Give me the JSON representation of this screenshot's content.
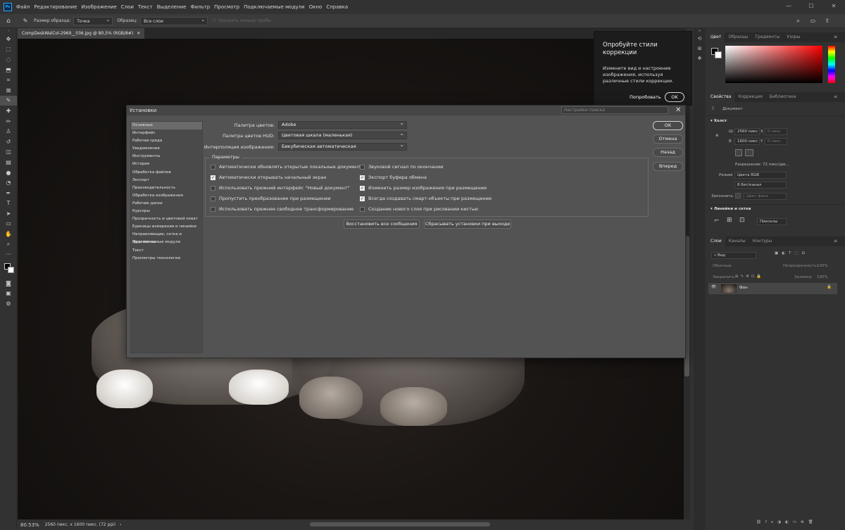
{
  "menubar": {
    "items": [
      "Файл",
      "Редактирование",
      "Изображение",
      "Слои",
      "Текст",
      "Выделение",
      "Фильтр",
      "Просмотр",
      "Подключаемые модули",
      "Окно",
      "Справка"
    ],
    "app_icon": "Ps"
  },
  "options_bar": {
    "sample_size_label": "Размер образца:",
    "sample_size_value": "Точка",
    "sample_label": "Образец:",
    "sample_value": "Все слои",
    "show_ring_label": "Показать кольцо пробы"
  },
  "document": {
    "tab_title": "CompDeskWalCol-2969__036.jpg @ 80,5% (RGB/8#)",
    "zoom": "80.53%",
    "info": "2560 пикс. x 1600 пикс. (72 ppi)"
  },
  "popup": {
    "title": "Опробуйте стили коррекции",
    "description": "Измените вид и настроение изображения, используя различные стили коррекции.",
    "try_label": "Попробовать",
    "ok_label": "OK"
  },
  "color_panel": {
    "tabs": [
      "Цвет",
      "Образцы",
      "Градиенты",
      "Узоры"
    ],
    "active": 0
  },
  "properties_panel": {
    "tabs": [
      "Свойства",
      "Коррекция",
      "Библиотеки"
    ],
    "active": 0,
    "doc_label": "Документ",
    "canvas_header": "Холст",
    "w_label": "Ш",
    "w_value": "2560 пикс",
    "h_label": "В",
    "h_value": "1600 пикс",
    "x_label": "X",
    "x_value": "0 пикс",
    "y_label": "Y",
    "y_value": "0 пикс",
    "resolution": "Разрешение: 72 пикс/дю...",
    "mode_label": "Режим",
    "mode_value": "Цвета RGB",
    "depth_value": "8 бит/канал",
    "fill_label": "Заполнить",
    "fill_value": "Цвет фона",
    "rulers_header": "Линейки и сетки",
    "units_value": "Пикселы"
  },
  "layers_panel": {
    "tabs": [
      "Слои",
      "Каналы",
      "Контуры"
    ],
    "active": 0,
    "search_placeholder": "Вид",
    "blend_mode": "Обычные",
    "opacity_label": "Непрозрачность:",
    "opacity_value": "100%",
    "lock_label": "Закрепить:",
    "fill_label": "Заливка:",
    "fill_value": "100%",
    "layer_name": "Фон"
  },
  "dialog": {
    "title": "Установки",
    "search_placeholder": "Настройки поиска",
    "categories": [
      "Основные",
      "Интерфейс",
      "Рабочая среда",
      "Уведомления",
      "Инструменты",
      "История",
      "Обработка файлов",
      "Экспорт",
      "Производительность",
      "Обработка изображения",
      "Рабочие диски",
      "Курсоры",
      "Прозрачность и цветовой охват",
      "Единицы измерения и линейки",
      "Направляющие, сетка и фрагменты",
      "Подключаемые модули",
      "Текст",
      "Просмотры технологии"
    ],
    "active_category": 0,
    "color_picker_label": "Палитра цветов:",
    "color_picker_value": "Adobe",
    "hud_label": "Палитра цветов HUD:",
    "hud_value": "Цветовая шкала (маленькая)",
    "interp_label": "Интерполяция изображения:",
    "interp_value": "Бикубическая автоматическая",
    "params_legend": "Параметры",
    "options_left": [
      {
        "label": "Автоматически обновлять открытые локальные документы",
        "checked": false
      },
      {
        "label": "Автоматически открывать начальный экран",
        "checked": true
      },
      {
        "label": "Использовать прежний интерфейс \"Новый документ\"",
        "checked": false
      },
      {
        "label": "Пропустить преобразование при размещении",
        "checked": false
      },
      {
        "label": "Использовать прежнее свободное трансформирование",
        "checked": false
      }
    ],
    "options_right": [
      {
        "label": "Звуковой сигнал по окончании",
        "checked": false
      },
      {
        "label": "Экспорт буфера обмена",
        "checked": true
      },
      {
        "label": "Изменить размер изображения при размещении",
        "checked": true
      },
      {
        "label": "Всегда создавать смарт-объекты при размещении",
        "checked": true
      },
      {
        "label": "Создание нового слоя при рисовании кистью",
        "checked": false
      }
    ],
    "restore_messages": "Восстановить все сообщения",
    "reset_on_exit": "Сбрасывать установки при выходе",
    "ok": "OK",
    "cancel": "Отмена",
    "prev": "Назад",
    "next": "Вперед"
  }
}
